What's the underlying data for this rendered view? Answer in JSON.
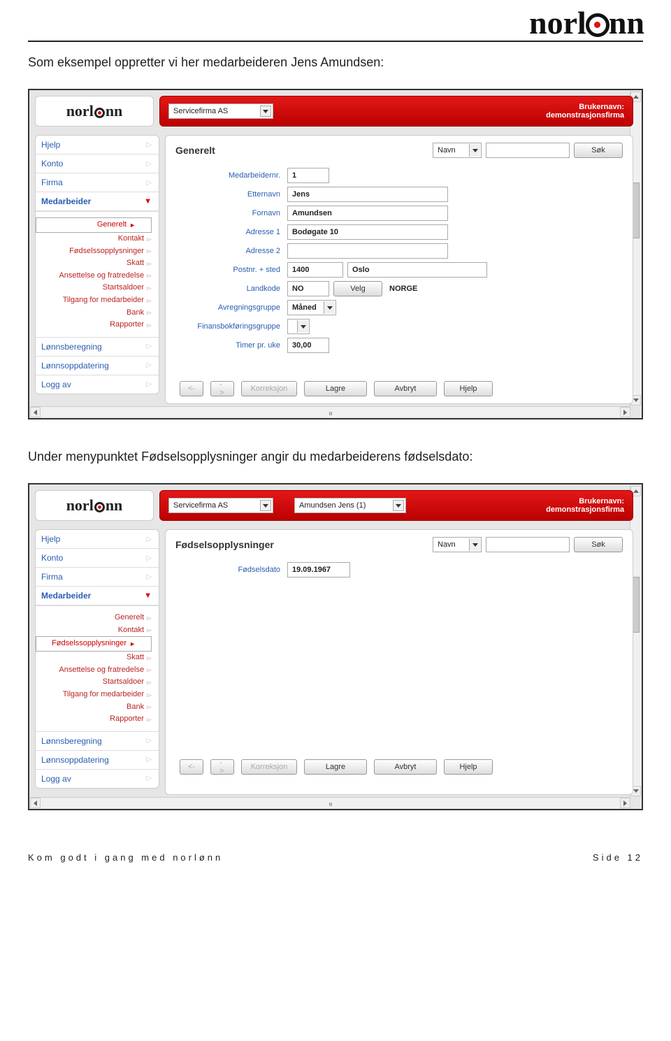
{
  "brand": "norlønn",
  "doc": {
    "p1": "Som eksempel oppretter vi her medarbeideren Jens Amundsen:",
    "p2": "Under menypunktet Fødselsopplysninger angir du medarbeiderens fødselsdato:"
  },
  "common": {
    "company": "Servicefirma AS",
    "user_line1": "Brukernavn:",
    "user_line2": "demonstrasjonsfirma",
    "search_type": "Navn",
    "search_btn": "Søk",
    "nav": [
      "Hjelp",
      "Konto",
      "Firma",
      "Medarbeider",
      "Lønnsberegning",
      "Lønnsoppdatering",
      "Logg av"
    ],
    "subnav": [
      "Generelt",
      "Kontakt",
      "Fødselssopplysninger",
      "Skatt",
      "Ansettelse og fratredelse",
      "Startsaldoer",
      "Tilgang for medarbeider",
      "Bank",
      "Rapporter"
    ],
    "btns": {
      "prev": "<-",
      "next": "->",
      "korr": "Korreksjon",
      "lagre": "Lagre",
      "avbryt": "Avbryt",
      "hjelp": "Hjelp"
    }
  },
  "shot1": {
    "title": "Generelt",
    "fields": {
      "nr_lbl": "Medarbeidernr.",
      "nr": "1",
      "ett_lbl": "Etternavn",
      "ett": "Jens",
      "for_lbl": "Fornavn",
      "for": "Amundsen",
      "a1_lbl": "Adresse 1",
      "a1": "Bodøgate 10",
      "a2_lbl": "Adresse 2",
      "a2": "",
      "post_lbl": "Postnr. + sted",
      "postnr": "1400",
      "sted": "Oslo",
      "land_lbl": "Landkode",
      "land": "NO",
      "velg": "Velg",
      "landn": "NORGE",
      "avr_lbl": "Avregningsgruppe",
      "avr": "Måned",
      "fin_lbl": "Finansbokføringsgruppe",
      "fin": "",
      "timer_lbl": "Timer pr. uke",
      "timer": "30,00"
    }
  },
  "shot2": {
    "title": "Fødselsopplysninger",
    "person": "Amundsen Jens (1)",
    "fd_lbl": "Fødselsdato",
    "fd": "19.09.1967"
  },
  "footer": {
    "left": "Kom godt i gang med norlønn",
    "right": "Side 12"
  }
}
